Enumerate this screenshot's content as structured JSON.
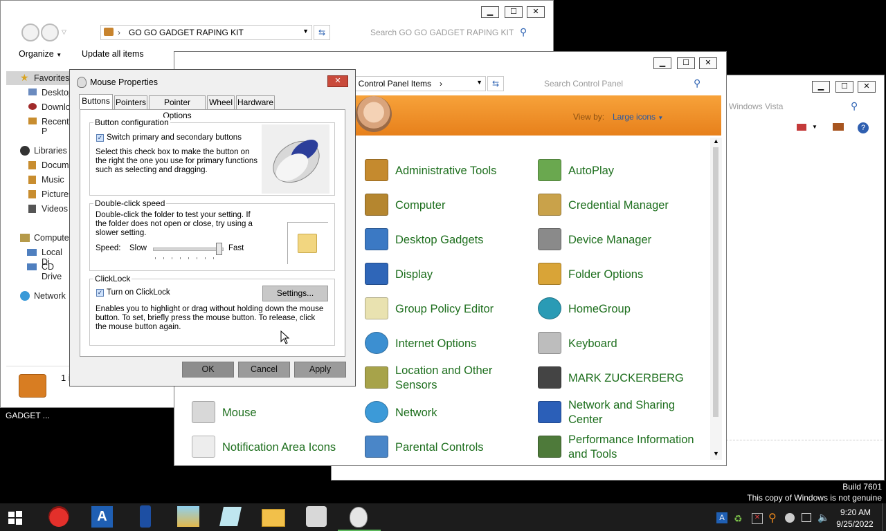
{
  "explorer": {
    "address": "GO GO GADGET RAPING KIT",
    "search_placeholder": "Search GO GO GADGET RAPING KIT",
    "organize_label": "Organize",
    "update_label": "Update all items",
    "nav": {
      "favorites": "Favorites",
      "desktop": "Desktop",
      "downloads": "Downlo",
      "recent": "Recent P",
      "libraries": "Libraries",
      "documents": "Docume",
      "music": "Music",
      "pictures": "Pictures",
      "videos": "Videos",
      "computer": "Compute",
      "local_disk": "Local Di",
      "cd_drive": "CD Drive",
      "network": "Network"
    },
    "status_count": "1 i"
  },
  "taskbar_preview_label": "GADGET ...",
  "vista_window": {
    "search_text": "Windows Vista"
  },
  "control_panel": {
    "breadcrumb": "ll Control Panel Items",
    "breadcrumb_arrow": "›",
    "search_placeholder": "Search Control Panel",
    "view_by_label": "View by:",
    "view_by_value": "Large icons",
    "items": [
      {
        "label": "Administrative Tools",
        "icon": "admin-tools"
      },
      {
        "label": "AutoPlay",
        "icon": "autoplay"
      },
      {
        "label": "Computer",
        "icon": "computer"
      },
      {
        "label": "Credential Manager",
        "icon": "credential"
      },
      {
        "label": "Desktop Gadgets",
        "icon": "gadgets"
      },
      {
        "label": "Device Manager",
        "icon": "device-manager"
      },
      {
        "label": "Display",
        "icon": "display"
      },
      {
        "label": "Folder Options",
        "icon": "folder-options"
      },
      {
        "label": "Group Policy Editor",
        "icon": "policy"
      },
      {
        "label": "HomeGroup",
        "icon": "homegroup"
      },
      {
        "label": "Internet Options",
        "icon": "internet"
      },
      {
        "label": "Keyboard",
        "icon": "keyboard"
      },
      {
        "label": "Location and Other Sensors",
        "icon": "location"
      },
      {
        "label": "MARK ZUCKERBERG",
        "icon": "user"
      },
      {
        "label": "Mouse",
        "icon": "mouse"
      },
      {
        "label": "Network",
        "icon": "network"
      },
      {
        "label": "Network and Sharing Center",
        "icon": "network-sharing"
      },
      {
        "label": "Notification Area Icons",
        "icon": "notification"
      },
      {
        "label": "Parental Controls",
        "icon": "parental"
      },
      {
        "label": "Performance Information and Tools",
        "icon": "performance"
      }
    ]
  },
  "mouse_dialog": {
    "title": "Mouse Properties",
    "close_glyph": "✕",
    "tabs": [
      "Buttons",
      "Pointers",
      "Pointer Options",
      "Wheel",
      "Hardware"
    ],
    "button_config": {
      "title": "Button configuration",
      "checkbox_label": "Switch primary and secondary buttons",
      "description": "Select this check box to make the button on the right the one you use for primary functions such as selecting and dragging."
    },
    "double_click": {
      "title": "Double-click speed",
      "description": "Double-click the folder to test your setting. If the folder does not open or close, try using a slower setting.",
      "speed_label": "Speed:",
      "slow_label": "Slow",
      "fast_label": "Fast",
      "speed_fraction": 0.95
    },
    "clicklock": {
      "title": "ClickLock",
      "checkbox_label": "Turn on ClickLock",
      "settings_label": "Settings...",
      "description": "Enables you to highlight or drag without holding down the mouse button. To set, briefly press the mouse button. To release, click the mouse button again."
    },
    "buttons": {
      "ok": "OK",
      "cancel": "Cancel",
      "apply": "Apply"
    }
  },
  "desktop_watermark": {
    "build": "Build 7601",
    "genuine": "This copy of Windows is not genuine"
  },
  "taskbar": {
    "time": "9:20 AM",
    "date": "9/25/2022",
    "apps": [
      "angry-birds",
      "word-editor",
      "phone",
      "gadget-kit",
      "paper",
      "file-explorer",
      "control-panel",
      "mouse-properties"
    ]
  },
  "colors": {
    "cp_header": "#f08a1c",
    "cp_link": "#1e6f1e",
    "taskbar": "#1a1a1a",
    "dialog_button": "#9b9b9b"
  }
}
